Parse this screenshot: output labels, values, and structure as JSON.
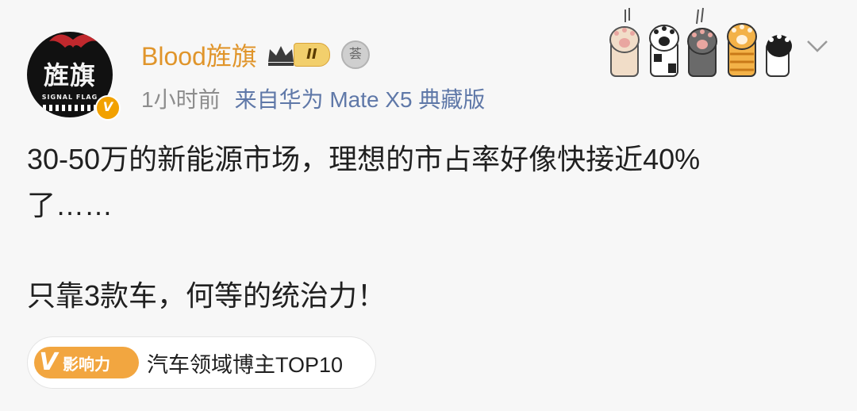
{
  "author": {
    "name": "Blood旌旗",
    "avatar_title": "旌旗",
    "avatar_subtitle": "SIGNAL FLAG",
    "verified_mark": "V",
    "vip_level": "II",
    "medal_label": "荟"
  },
  "post_meta": {
    "time": "1小时前",
    "source": "来自华为 Mate X5 典藏版"
  },
  "post": {
    "line1": "30-50万的新能源市场，理想的市占率好像快接近40%",
    "line2": "了……",
    "line3": "只靠3款车，何等的统治力！"
  },
  "influence": {
    "mark": "V",
    "badge_label": "影响力",
    "text": "汽车领域博主TOP10"
  },
  "icons": {
    "menu": "chevron-down-icon",
    "stickers": [
      "cat-paw-icon",
      "cat-paw-icon",
      "cat-paw-icon",
      "cat-paw-icon",
      "cat-paw-icon"
    ]
  },
  "colors": {
    "username": "#e0952b",
    "source": "#5f78a8",
    "influence": "#f2a640"
  }
}
